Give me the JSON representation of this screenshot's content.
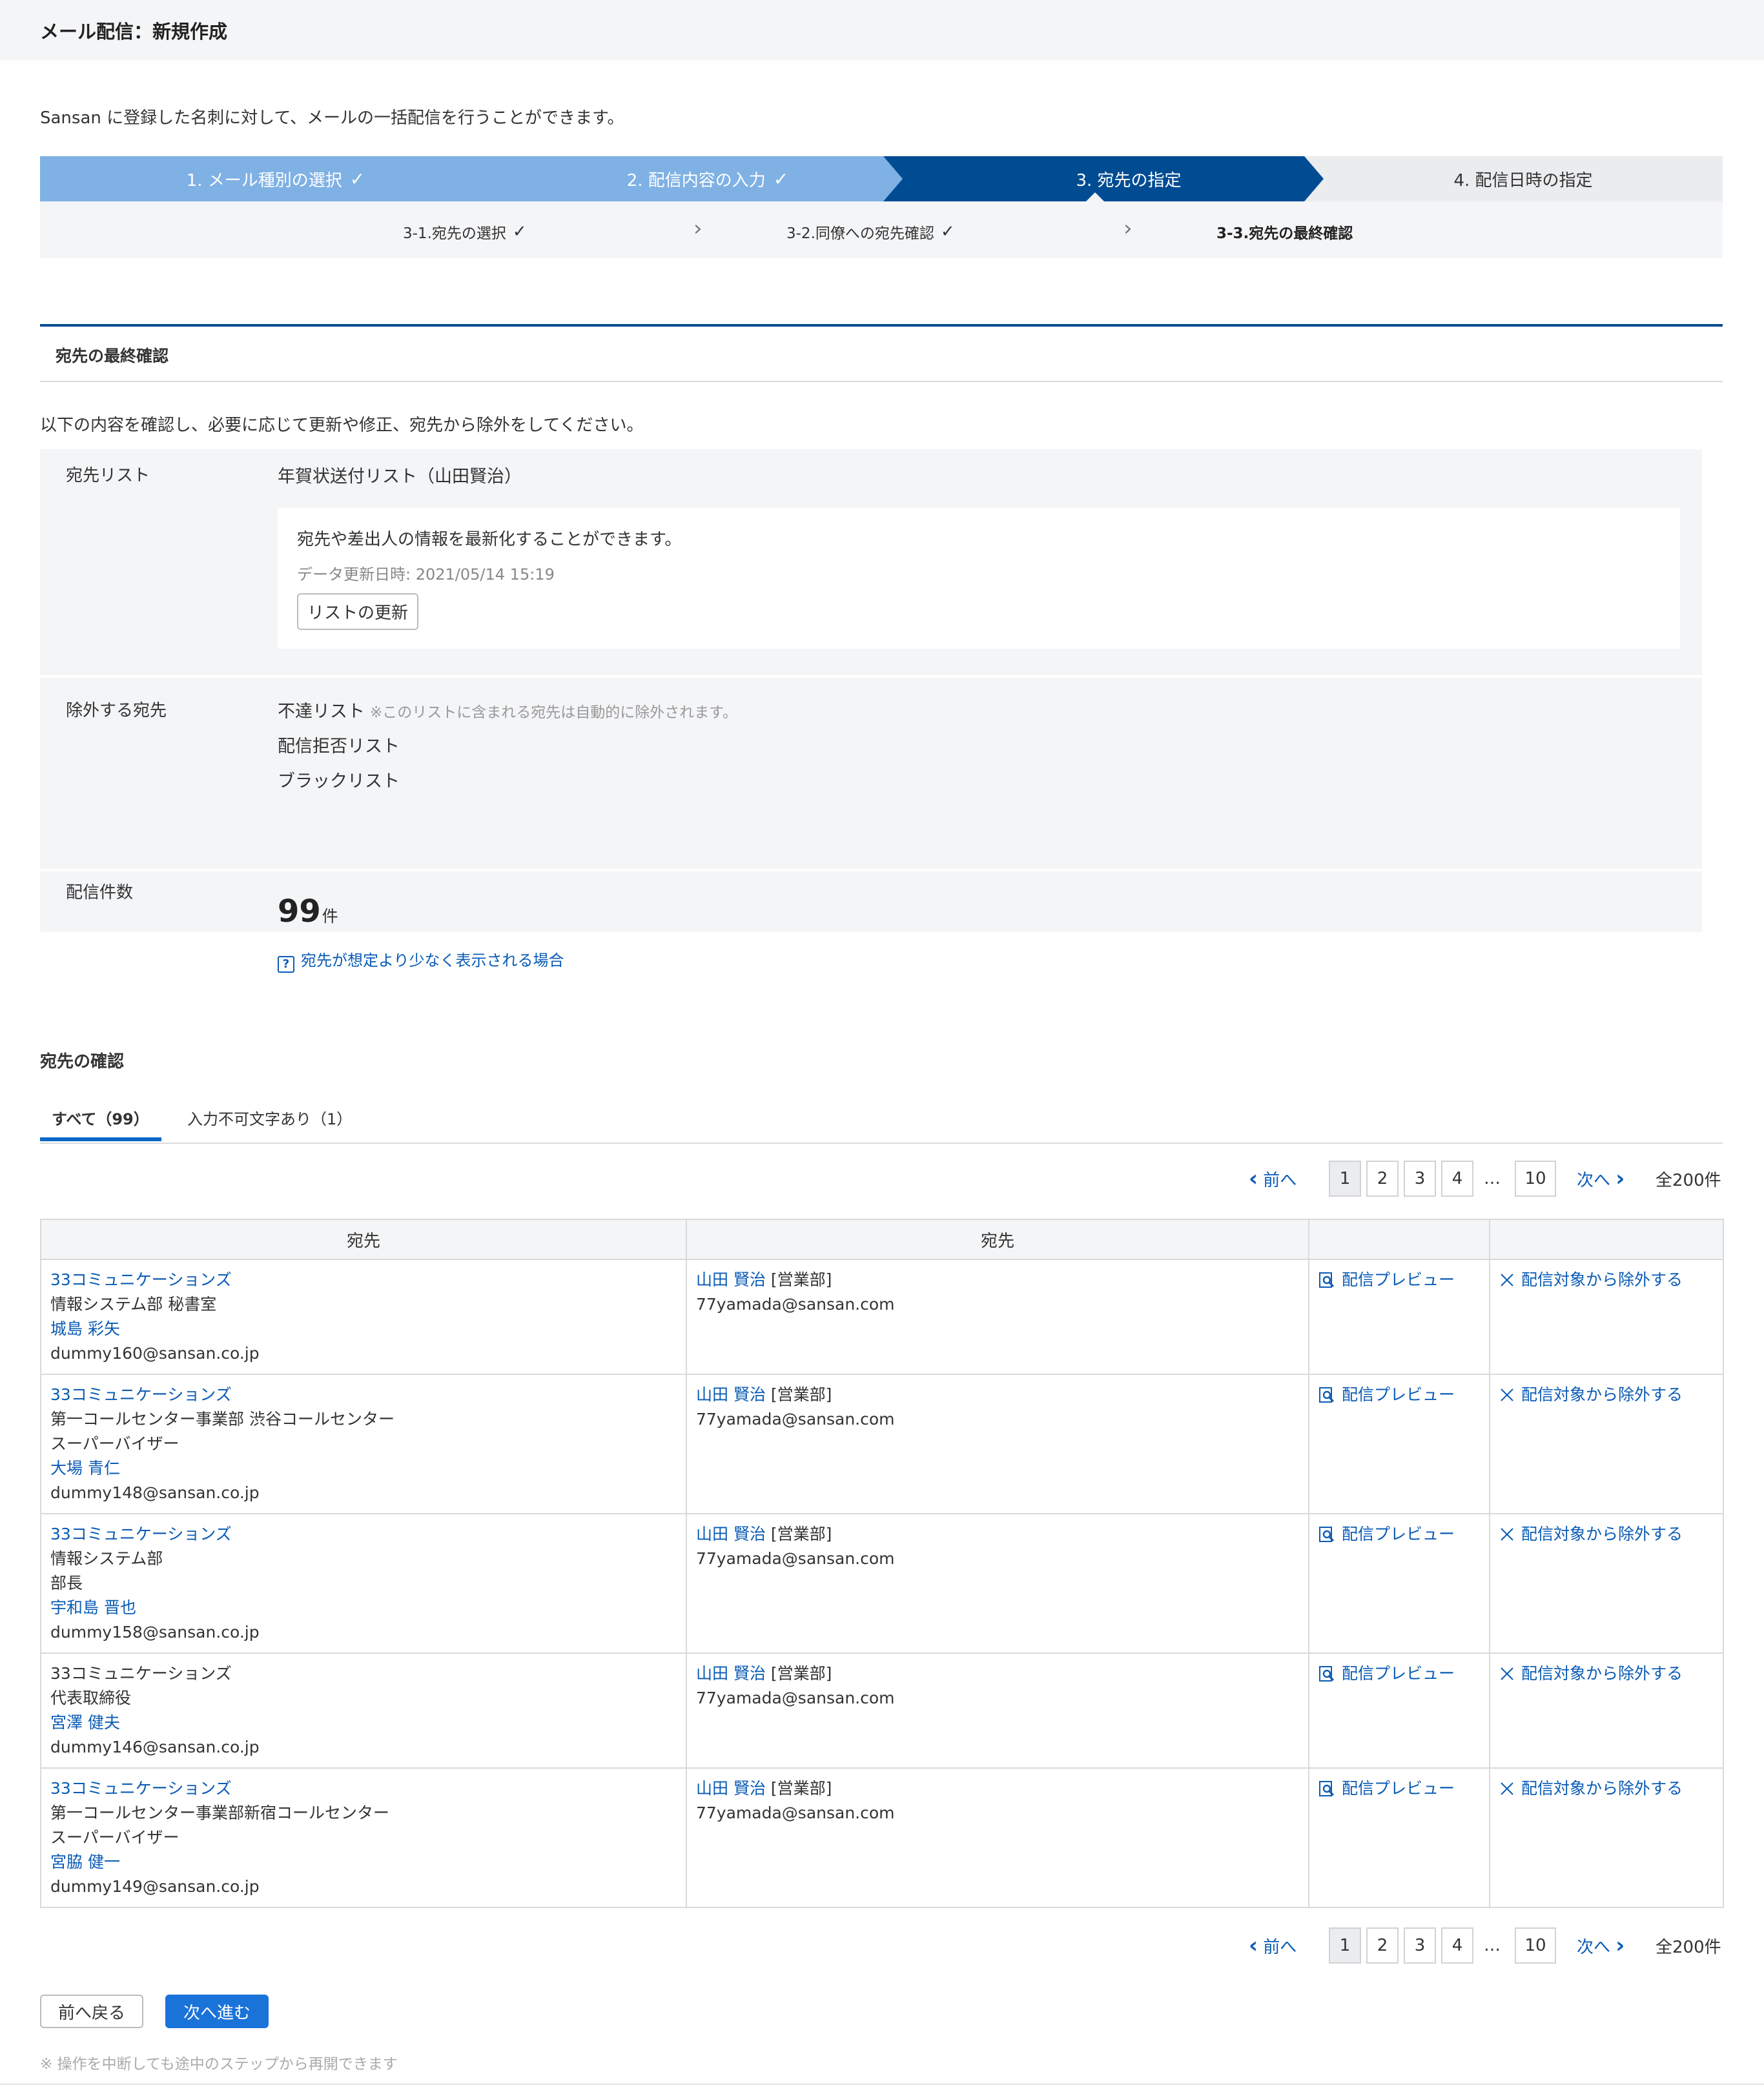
{
  "page": {
    "title": "メール配信：新規作成",
    "intro": "Sansan に登録した名刺に対して、メールの一括配信を行うことができます。"
  },
  "steps": [
    {
      "label": "1. メール種別の選択",
      "state": "done"
    },
    {
      "label": "2. 配信内容の入力",
      "state": "done"
    },
    {
      "label": "3. 宛先の指定",
      "state": "active"
    },
    {
      "label": "4. 配信日時の指定",
      "state": "todo"
    }
  ],
  "substeps": [
    {
      "label": "3-1.宛先の選択",
      "state": "done"
    },
    {
      "label": "3-2.同僚への宛先確認",
      "state": "done"
    },
    {
      "label": "3-3.宛先の最終確認",
      "state": "current"
    }
  ],
  "section": {
    "title": "宛先の最終確認",
    "description": "以下の内容を確認し、必要に応じて更新や修正、宛先から除外をしてください。"
  },
  "info": {
    "list_label": "宛先リスト",
    "list_name": "年賀状送付リスト（山田賢治）",
    "refresh_text": "宛先や差出人の情報を最新化することができます。",
    "updated_at": "データ更新日時: 2021/05/14 15:19",
    "refresh_button": "リストの更新",
    "exclude_label": "除外する宛先",
    "exclude_items": [
      "不達リスト",
      "配信拒否リスト",
      "ブラックリスト"
    ],
    "exclude_note": "※このリストに含まれる宛先は自動的に除外されます。",
    "count_label": "配信件数",
    "count": "99",
    "count_unit": "件",
    "help_link": "宛先が想定より少なく表示される場合"
  },
  "dest": {
    "heading": "宛先の確認",
    "tabs": [
      "すべて（99）",
      "入力不可文字あり（1）"
    ]
  },
  "pager": {
    "prev": "前へ",
    "next": "次へ",
    "pages": [
      "1",
      "2",
      "3",
      "4",
      "10"
    ],
    "ellipsis": "…",
    "total": "全200件"
  },
  "table": {
    "headers": [
      "宛先",
      "宛先",
      "",
      ""
    ],
    "preview_label": "配信プレビュー",
    "exclude_label": "配信対象から除外する",
    "rows": [
      {
        "company": "33コミュニケーションズ",
        "company_link": true,
        "dept": "情報システム部 秘書室",
        "title": "",
        "person": "城島 彩矢",
        "email": "dummy160@sansan.co.jp",
        "sender": "山田 賢治",
        "sender_dept": "[営業部]",
        "sender_email": "77yamada@sansan.com"
      },
      {
        "company": "33コミュニケーションズ",
        "company_link": true,
        "dept": "第一コールセンター事業部 渋谷コールセンター",
        "title": "スーパーバイザー",
        "person": "大場 青仁",
        "email": "dummy148@sansan.co.jp",
        "sender": "山田 賢治",
        "sender_dept": "[営業部]",
        "sender_email": "77yamada@sansan.com"
      },
      {
        "company": "33コミュニケーションズ",
        "company_link": true,
        "dept": "情報システム部",
        "title": "部長",
        "person": "宇和島 晋也",
        "email": "dummy158@sansan.co.jp",
        "sender": "山田 賢治",
        "sender_dept": "[営業部]",
        "sender_email": "77yamada@sansan.com"
      },
      {
        "company": "33コミュニケーションズ",
        "company_link": false,
        "dept": "代表取締役",
        "title": "",
        "person": "宮澤 健夫",
        "email": "dummy146@sansan.co.jp",
        "sender": "山田 賢治",
        "sender_dept": "[営業部]",
        "sender_email": "77yamada@sansan.com"
      },
      {
        "company": "33コミュニケーションズ",
        "company_link": true,
        "dept": "第一コールセンター事業部新宿コールセンター",
        "title": "スーパーバイザー",
        "person": "宮脇 健一",
        "email": "dummy149@sansan.co.jp",
        "sender": "山田 賢治",
        "sender_dept": "[営業部]",
        "sender_email": "77yamada@sansan.com"
      }
    ]
  },
  "footer": {
    "back": "前へ戻る",
    "next": "次へ進む",
    "note": "※ 操作を中断しても途中のステップから再開できます"
  },
  "colors": {
    "primary": "#004c93",
    "done": "#7fb1e4",
    "link": "#0a5bb5",
    "button": "#1a73d9"
  }
}
